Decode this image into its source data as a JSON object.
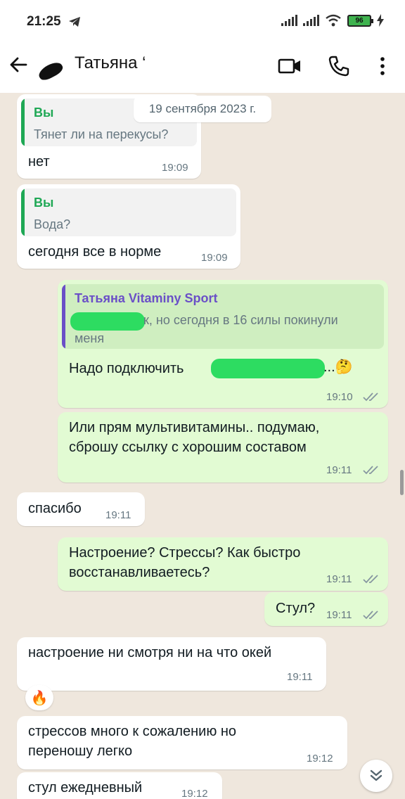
{
  "status_bar": {
    "time": "21:25",
    "battery": "96"
  },
  "header": {
    "contact_name": "Татьяна ‘"
  },
  "date_chip": "19 сентября 2023 г.",
  "messages": [
    {
      "dir": "in",
      "quote": {
        "author": "Вы",
        "text": "Тянет ли на перекусы?"
      },
      "text": "нет",
      "time": "19:09"
    },
    {
      "dir": "in",
      "quote": {
        "author": "Вы",
        "text": "Вода?"
      },
      "text": "сегодня все в норме",
      "time": "19:09"
    },
    {
      "dir": "out",
      "quote": {
        "author": "Татьяна Vitaminy Sport",
        "text_line1": "к, но сегодня в 16 силы покинули",
        "text_line2": "меня"
      },
      "text": "Надо подключить",
      "text_suffix": "...🤔",
      "time": "19:10",
      "status": "read"
    },
    {
      "dir": "out",
      "text_line1": "Или прям мультивитамины.. подумаю,",
      "text_line2": "сброшу ссылку с хорошим составом",
      "time": "19:11",
      "status": "read"
    },
    {
      "dir": "in",
      "text": "спасибо",
      "time": "19:11"
    },
    {
      "dir": "out",
      "text_line1": "Настроение? Стрессы? Как быстро",
      "text_line2": "восстанавливаетесь?",
      "time": "19:11",
      "status": "read"
    },
    {
      "dir": "out",
      "text": "Стул?",
      "time": "19:11",
      "status": "read"
    },
    {
      "dir": "in",
      "text": "настроение ни смотря ни на что окей",
      "time": "19:11",
      "reaction": "🔥"
    },
    {
      "dir": "in",
      "text_line1": "стрессов много к сожалению но",
      "text_line2": "переношу легко",
      "time": "19:12"
    },
    {
      "dir": "in",
      "text": "стул ежедневный",
      "time": "19:12"
    }
  ],
  "colors": {
    "wallpaper": "#efe7dd",
    "incoming": "#ffffff",
    "outgoing": "#e2fbd3",
    "you_author": "#1fa855",
    "contact_author": "#6a4fc7",
    "tick": "#8696a0"
  },
  "icons": [
    "telegram-icon",
    "signal-icon",
    "wifi-icon",
    "battery-icon",
    "charging-icon",
    "back-arrow-icon",
    "video-call-icon",
    "voice-call-icon",
    "more-vert-icon",
    "double-check-icon",
    "chevrons-down-icon"
  ]
}
